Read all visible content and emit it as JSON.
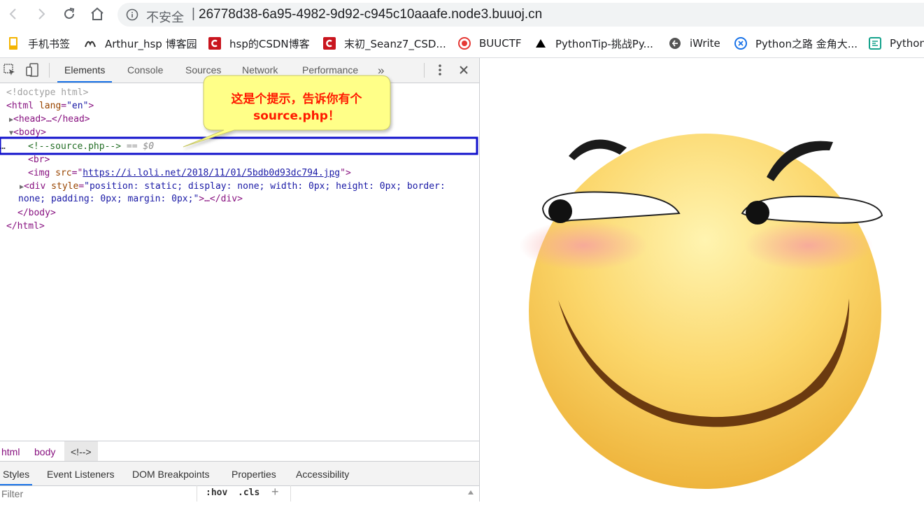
{
  "address_bar": {
    "security_label": "不安全",
    "separator": "|",
    "url": "26778d38-6a95-4982-9d92-c945c10aaafe.node3.buuoj.cn"
  },
  "bookmarks": [
    {
      "label": "手机书签",
      "icon": "bookmark-mobile-icon",
      "color": "#f4b400"
    },
    {
      "label": "Arthur_hsp 博客园",
      "icon": "cnblogs-icon",
      "color": "#333333"
    },
    {
      "label": "hsp的CSDN博客",
      "icon": "csdn-icon",
      "color": "#c9151e"
    },
    {
      "label": "末初_Seanz7_CSD...",
      "icon": "csdn-icon",
      "color": "#c9151e"
    },
    {
      "label": "BUUCTF",
      "icon": "buuctf-icon",
      "color": "#e53935"
    },
    {
      "label": "PythonTip-挑战Py...",
      "icon": "triangle-icon",
      "color": "#000000"
    },
    {
      "label": "iWrite",
      "icon": "iwrite-icon",
      "color": "#555555"
    },
    {
      "label": "Python之路 金角大...",
      "icon": "python-road-icon",
      "color": "#1a73e8"
    },
    {
      "label": "Python",
      "icon": "python-icon",
      "color": "#15a28c"
    }
  ],
  "devtools": {
    "tabs": [
      "Elements",
      "Console",
      "Sources",
      "Network",
      "Performance"
    ],
    "overflow": "»",
    "dom": {
      "doctype": "<!doctype html>",
      "html_open_tag": "html",
      "html_attr": "lang",
      "html_attr_val": "\"en\"",
      "head_collapsed": "<head>…</head>",
      "body_open": "<body>",
      "comment": "<!--source.php-->",
      "selected_suffix": " == $0",
      "br": "<br>",
      "img_tag": "img",
      "img_attr": "src",
      "img_src": "https://i.loli.net/2018/11/01/5bdb0d93dc794.jpg",
      "div_tag": "div",
      "div_attr": "style",
      "div_style_1": "\"position: static; display: none; width: 0px; height: 0px; border:",
      "div_style_2": "none; padding: 0px; margin: 0px;\"",
      "div_close": ">…</div>",
      "body_close": "</body>",
      "html_close": "</html>"
    },
    "breadcrumbs": [
      "html",
      "body",
      "<!-->"
    ],
    "subtabs": [
      "Styles",
      "Event Listeners",
      "DOM Breakpoints",
      "Properties",
      "Accessibility"
    ],
    "filter_placeholder": "Filter",
    "hov": ":hov",
    "cls": ".cls",
    "add": "+"
  },
  "callout": {
    "line1": "这是个提示，告诉你有个",
    "line2": "source.php！",
    "bg_color": "#ffff88",
    "text_color": "#ff1a00",
    "highlight_color": "#1111cc"
  }
}
